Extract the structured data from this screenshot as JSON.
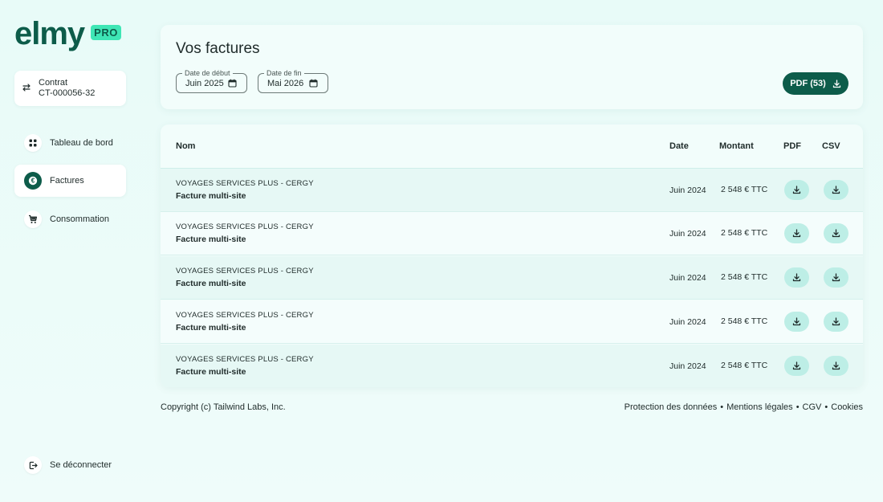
{
  "brand": {
    "name": "elmy",
    "badge": "PRO",
    "color": "#0d5c4a",
    "accent": "#3ee6b5"
  },
  "contract": {
    "label": "Contrat",
    "id": "CT-000056-32",
    "icon": "swap-icon"
  },
  "nav": {
    "items": [
      {
        "label": "Tableau de bord",
        "icon": "grid-icon",
        "active": false
      },
      {
        "label": "Factures",
        "icon": "euro-icon",
        "active": true
      },
      {
        "label": "Consommation",
        "icon": "cart-icon",
        "active": false
      }
    ],
    "logout": "Se déconnecter"
  },
  "header": {
    "title": "Vos factures",
    "start_date": {
      "legend": "Date de début",
      "value": "Juin 2025"
    },
    "end_date": {
      "legend": "Date de fin",
      "value": "Mai 2026"
    },
    "pdf_button": "PDF (53)"
  },
  "table": {
    "columns": {
      "name": "Nom",
      "date": "Date",
      "amount": "Montant",
      "pdf": "PDF",
      "csv": "CSV"
    },
    "rows": [
      {
        "company": "VOYAGES SERVICES PLUS - CERGY",
        "desc": "Facture multi-site",
        "date": "Juin 2024",
        "amount": "2 548 € TTC"
      },
      {
        "company": "VOYAGES SERVICES PLUS - CERGY",
        "desc": "Facture multi-site",
        "date": "Juin 2024",
        "amount": "2 548 € TTC"
      },
      {
        "company": "VOYAGES SERVICES PLUS - CERGY",
        "desc": "Facture multi-site",
        "date": "Juin 2024",
        "amount": "2 548 € TTC"
      },
      {
        "company": "VOYAGES SERVICES PLUS - CERGY",
        "desc": "Facture multi-site",
        "date": "Juin 2024",
        "amount": "2 548 € TTC"
      },
      {
        "company": "VOYAGES SERVICES PLUS - CERGY",
        "desc": "Facture multi-site",
        "date": "Juin 2024",
        "amount": "2 548 € TTC"
      }
    ]
  },
  "footer": {
    "copyright": "Copyright (c) Tailwind Labs, Inc.",
    "links": [
      "Protection des données",
      "Mentions légales",
      "CGV",
      "Cookies"
    ],
    "separator": "•"
  }
}
